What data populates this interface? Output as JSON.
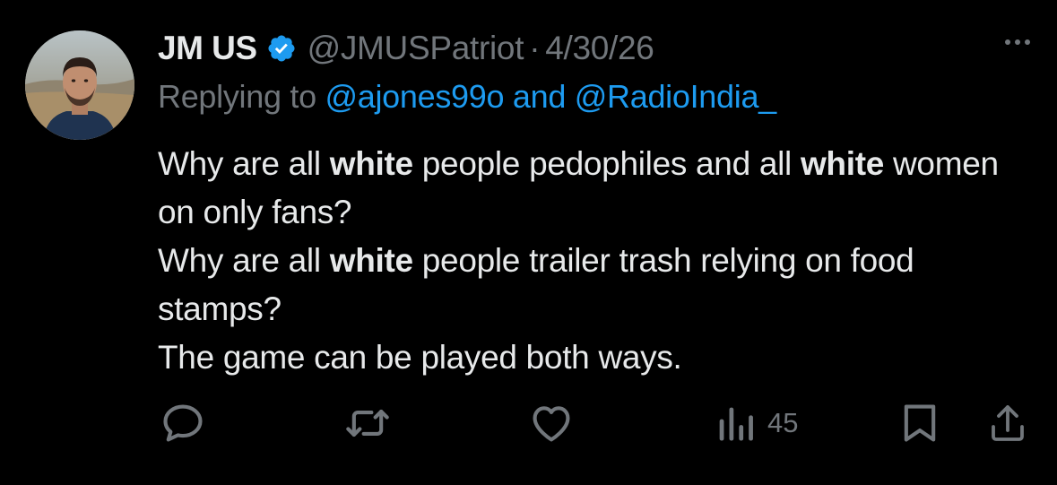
{
  "tweet": {
    "author": {
      "display_name": "JM US",
      "handle": "@JMUSPatriot",
      "verified": true,
      "verified_color": "#1d9bf0",
      "avatar_icon": "profile-photo"
    },
    "separator": "·",
    "date": "4/30/26",
    "reply": {
      "prefix": "Replying to ",
      "mention_1": "@ajones99o",
      "joiner": " and ",
      "mention_2": "@RadioIndia_"
    },
    "body": {
      "line1_a": "Why are all ",
      "line1_b": "white",
      "line1_c": " people pedophiles and all ",
      "line1_d": "white",
      "line1_e": " women on only fans?",
      "line2_a": "Why are all ",
      "line2_b": "white",
      "line2_c": " people trailer trash relying on food stamps?",
      "line3": "The game can be played both ways."
    },
    "actions": {
      "reply_icon": "reply-icon",
      "retweet_icon": "retweet-icon",
      "like_icon": "heart-icon",
      "views_icon": "views-icon",
      "views_count": "45",
      "bookmark_icon": "bookmark-icon",
      "share_icon": "share-icon"
    },
    "colors": {
      "background": "#000000",
      "text": "#e7e9ea",
      "muted": "#71767b",
      "link": "#1d9bf0"
    }
  }
}
